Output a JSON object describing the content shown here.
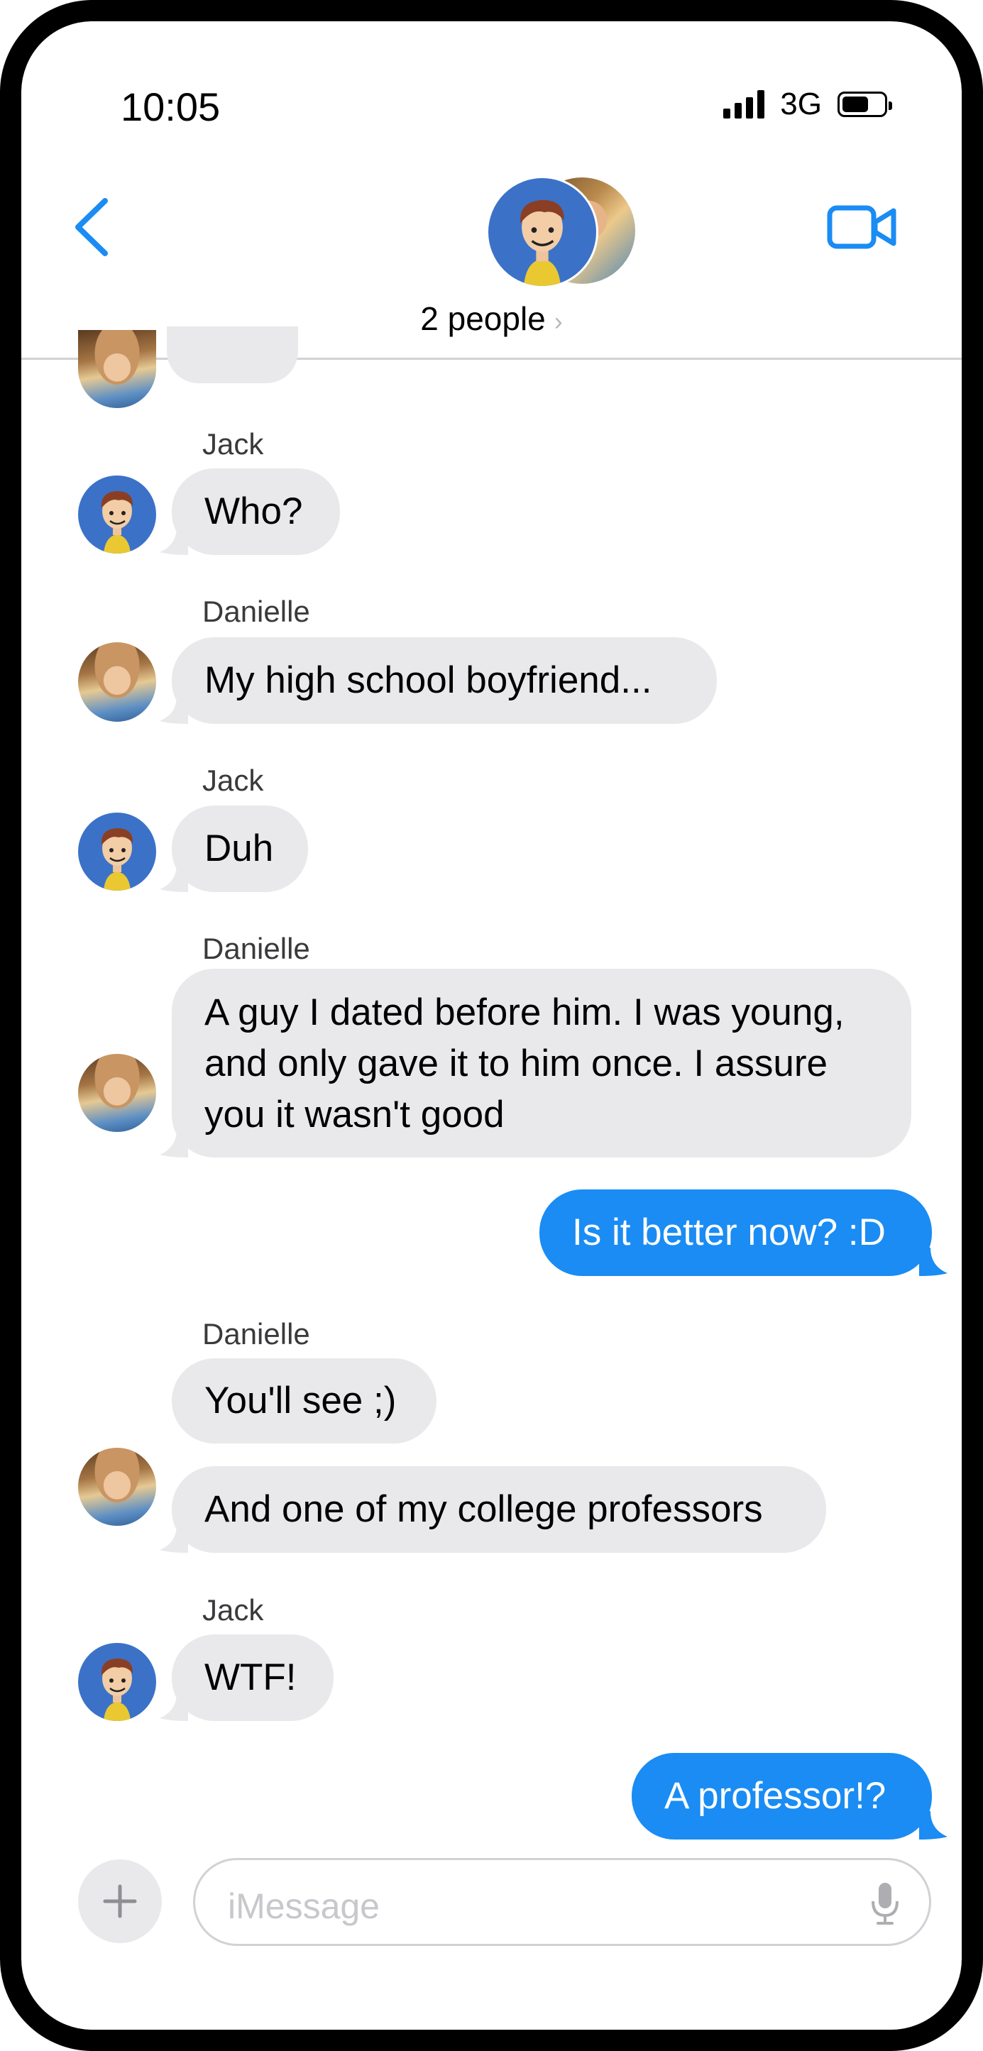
{
  "status_bar": {
    "time": "10:05",
    "network": "3G"
  },
  "header": {
    "title": "2 people",
    "chevron": "›"
  },
  "icons": {
    "back": "chevron-left-icon",
    "video": "video-camera-icon",
    "plus": "plus-icon",
    "mic": "microphone-icon"
  },
  "colors": {
    "accent": "#1a8cf3",
    "incoming_bubble": "#e9e9eb",
    "outgoing_bubble": "#1a8cf3"
  },
  "messages": [
    {
      "sender": "Jack",
      "direction": "incoming",
      "lines": [
        "Who?"
      ]
    },
    {
      "sender": "Danielle",
      "direction": "incoming",
      "lines": [
        "My high school boyfriend..."
      ]
    },
    {
      "sender": "Jack",
      "direction": "incoming",
      "lines": [
        "Duh"
      ]
    },
    {
      "sender": "Danielle",
      "direction": "incoming",
      "lines": [
        "A guy I dated before him.  I was young,",
        "and only gave it to him once.  I assure",
        "you it wasn't good"
      ]
    },
    {
      "sender": "",
      "direction": "outgoing",
      "lines": [
        "Is it better now? :D"
      ]
    },
    {
      "sender": "Danielle",
      "direction": "incoming",
      "lines": [
        "You'll see ;)"
      ]
    },
    {
      "sender": "",
      "direction": "incoming",
      "lines": [
        "And one of my college professors"
      ]
    },
    {
      "sender": "Jack",
      "direction": "incoming",
      "lines": [
        "WTF!"
      ]
    },
    {
      "sender": "",
      "direction": "outgoing",
      "lines": [
        "A professor!?"
      ]
    }
  ],
  "compose": {
    "placeholder": "iMessage"
  }
}
